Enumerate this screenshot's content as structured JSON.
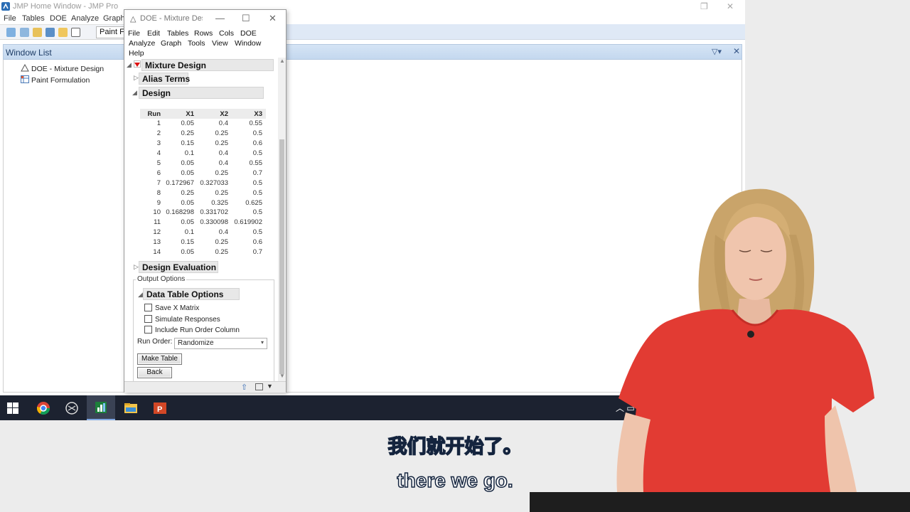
{
  "home": {
    "title": "JMP Home Window - JMP Pro",
    "menu": [
      "File",
      "Tables",
      "DOE",
      "Analyze",
      "Graph"
    ],
    "paint_tab": "Paint Formulation",
    "window_list_title": "Window List",
    "window_list_items": [
      {
        "label": "DOE - Mixture Design",
        "icon": "doe-triangle-icon"
      },
      {
        "label": "Paint Formulation",
        "icon": "data-table-icon"
      }
    ]
  },
  "doe": {
    "title": "DOE - Mixture Design",
    "menu": [
      "File",
      "Edit",
      "Tables",
      "Rows",
      "Cols",
      "DOE",
      "Analyze",
      "Graph",
      "Tools",
      "View",
      "Window",
      "Help"
    ],
    "section_title": "Mixture Design",
    "alias_terms": "Alias Terms",
    "design_title": "Design",
    "design_table": {
      "headers": [
        "Run",
        "X1",
        "X2",
        "X3"
      ],
      "rows": [
        [
          "1",
          "0.05",
          "0.4",
          "0.55"
        ],
        [
          "2",
          "0.25",
          "0.25",
          "0.5"
        ],
        [
          "3",
          "0.15",
          "0.25",
          "0.6"
        ],
        [
          "4",
          "0.1",
          "0.4",
          "0.5"
        ],
        [
          "5",
          "0.05",
          "0.4",
          "0.55"
        ],
        [
          "6",
          "0.05",
          "0.25",
          "0.7"
        ],
        [
          "7",
          "0.172967",
          "0.327033",
          "0.5"
        ],
        [
          "8",
          "0.25",
          "0.25",
          "0.5"
        ],
        [
          "9",
          "0.05",
          "0.325",
          "0.625"
        ],
        [
          "10",
          "0.168298",
          "0.331702",
          "0.5"
        ],
        [
          "11",
          "0.05",
          "0.330098",
          "0.619902"
        ],
        [
          "12",
          "0.1",
          "0.4",
          "0.5"
        ],
        [
          "13",
          "0.15",
          "0.25",
          "0.6"
        ],
        [
          "14",
          "0.05",
          "0.25",
          "0.7"
        ]
      ]
    },
    "design_evaluation": "Design Evaluation",
    "output_options": "Output Options",
    "data_table_options": "Data Table Options",
    "checkboxes": [
      "Save X Matrix",
      "Simulate Responses",
      "Include Run Order Column"
    ],
    "run_order_label": "Run Order:",
    "run_order_value": "Randomize",
    "make_table": "Make Table",
    "back": "Back"
  },
  "taskbar": {
    "apps": [
      "windows-start-icon",
      "chrome-icon",
      "app-circle-icon",
      "jmp-icon",
      "file-explorer-icon",
      "powerpoint-icon"
    ]
  },
  "subtitles": {
    "chinese": "我们就开始了。",
    "english": "there we go."
  },
  "colors": {
    "accent_blue": "#d5e4f5",
    "shirt_red": "#e23b33",
    "taskbar": "#1c2230",
    "subtitle_outline": "#14243e"
  }
}
